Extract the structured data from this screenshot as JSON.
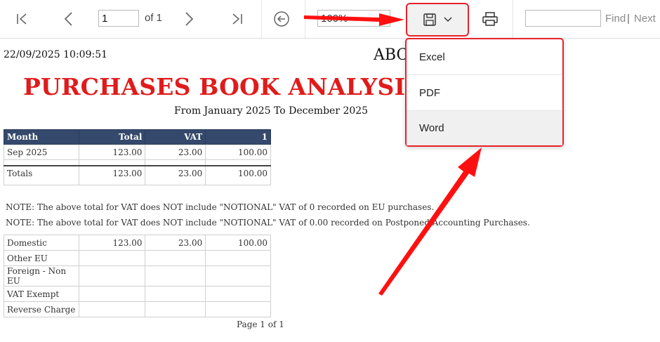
{
  "toolbar": {
    "page_number": "1",
    "page_of": "of 1",
    "zoom": "100%",
    "find_label": "Find",
    "find_separator": "|",
    "next_label": "Next",
    "icons": [
      "first-page-icon",
      "previous-page-icon",
      "next-page-icon",
      "last-page-icon",
      "back-icon",
      "save-icon",
      "chevron-down-icon",
      "print-icon"
    ]
  },
  "export_menu": {
    "items": [
      {
        "label": "Excel"
      },
      {
        "label": "PDF"
      },
      {
        "label": "Word"
      }
    ],
    "highlighted": "Word"
  },
  "report": {
    "timestamp": "22/09/2025 10:09:51",
    "company": "ABC",
    "title": "PURCHASES BOOK ANALYSIS SUM",
    "date_range": "From January 2025 To December 2025",
    "summary_table": {
      "headers": [
        "Month",
        "Total",
        "VAT",
        "1"
      ],
      "rows": [
        [
          "Sep 2025",
          "123.00",
          "23.00",
          "100.00"
        ]
      ],
      "totals": [
        "Totals",
        "123.00",
        "23.00",
        "100.00"
      ]
    },
    "notes": [
      "NOTE:   The above total for VAT does NOT include \"NOTIONAL\" VAT of 0 recorded on EU purchases.",
      "NOTE:   The above total for VAT does NOT include \"NOTIONAL\" VAT of 0.00 recorded on Postponed Accounting Purchases."
    ],
    "breakdown_table": {
      "rows": [
        [
          "Domestic",
          "123.00",
          "23.00",
          "100.00"
        ],
        [
          "Other EU",
          "",
          "",
          ""
        ],
        [
          "Foreign - Non EU",
          "",
          "",
          ""
        ],
        [
          "VAT Exempt",
          "",
          "",
          ""
        ],
        [
          "Reverse Charge",
          "",
          "",
          ""
        ]
      ]
    },
    "footer": "Page 1 of 1"
  },
  "colors": {
    "title_red": "#e01b1b",
    "header_navy": "#34496b",
    "highlight_red": "#e8222a"
  }
}
